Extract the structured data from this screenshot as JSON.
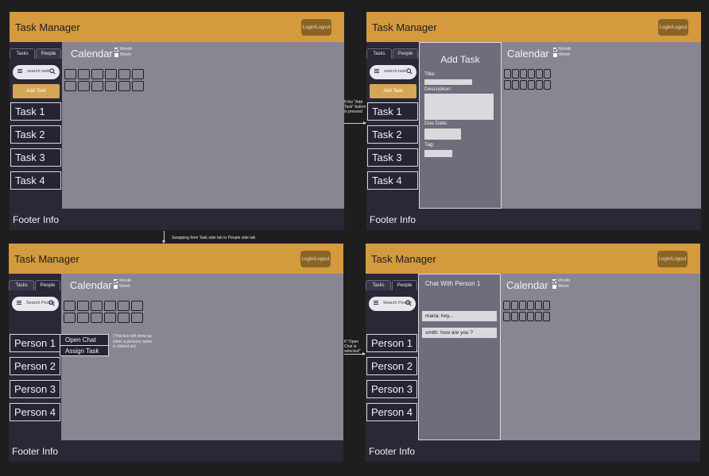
{
  "app": {
    "title": "Task Manager",
    "login_label": "Login/Logout",
    "footer": "Footer Info"
  },
  "sidebar": {
    "tab_tasks": "Tasks",
    "tab_people": "People",
    "search_tasks_placeholder": "search task",
    "search_people_placeholder": "Search People",
    "add_task_label": "Add Task",
    "tasks": [
      "Task 1",
      "Task 2",
      "Task 3",
      "Task 4"
    ],
    "people": [
      "Person 1",
      "Person 2",
      "Person 3",
      "Person 4"
    ]
  },
  "calendar": {
    "title": "Calendar",
    "opt_month": "Month",
    "opt_week": "Week",
    "month_checked": true
  },
  "add_task_panel": {
    "title": "Add Task",
    "title_label": "Title:",
    "description_label": "Description:",
    "due_label": "Due Date:",
    "tag_label": "Tag:"
  },
  "person_popup": {
    "open_chat": "Open Chat",
    "assign_task": "Assign Task",
    "note": "(This box will show up when a persons name is clicked on)"
  },
  "chat_panel": {
    "title": "Chat With Person 1",
    "messages": [
      "maria: hey...",
      "smith: how are you ?"
    ]
  },
  "annotations": {
    "add_task_pressed": "If the \"Add Task\" button is pressed",
    "swap_tabs": "Swapping from Task side tab to People side tab",
    "open_chat_selected": "If \"Open Chat is selected\""
  }
}
